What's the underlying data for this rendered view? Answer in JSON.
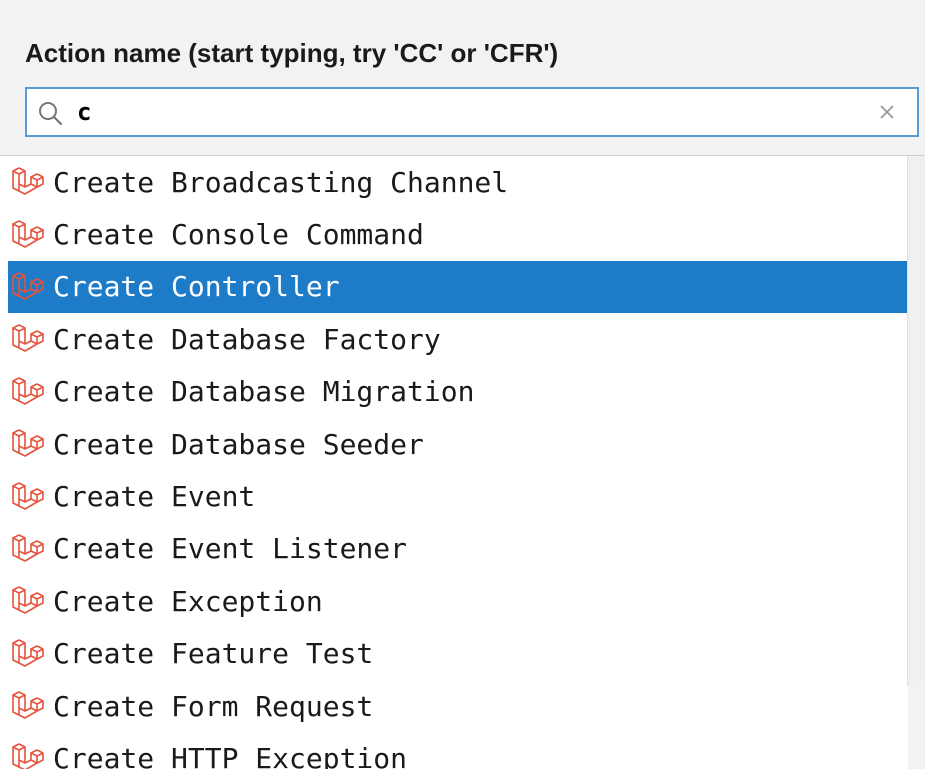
{
  "header": {
    "label": "Action name (start typing, try 'CC' or 'CFR')"
  },
  "search": {
    "value": "c",
    "search_icon": "search-icon",
    "clear_icon": "close-icon"
  },
  "actions": {
    "icon": "laravel-icon",
    "icon_color": "#e5533d",
    "selected_color": "#1e7bc8",
    "selected_index": 2,
    "items": [
      {
        "label": "Create Broadcasting Channel"
      },
      {
        "label": "Create Console Command"
      },
      {
        "label": "Create Controller"
      },
      {
        "label": "Create Database Factory"
      },
      {
        "label": "Create Database Migration"
      },
      {
        "label": "Create Database Seeder"
      },
      {
        "label": "Create Event"
      },
      {
        "label": "Create Event Listener"
      },
      {
        "label": "Create Exception"
      },
      {
        "label": "Create Feature Test"
      },
      {
        "label": "Create Form Request"
      },
      {
        "label": "Create HTTP Exception"
      }
    ]
  }
}
